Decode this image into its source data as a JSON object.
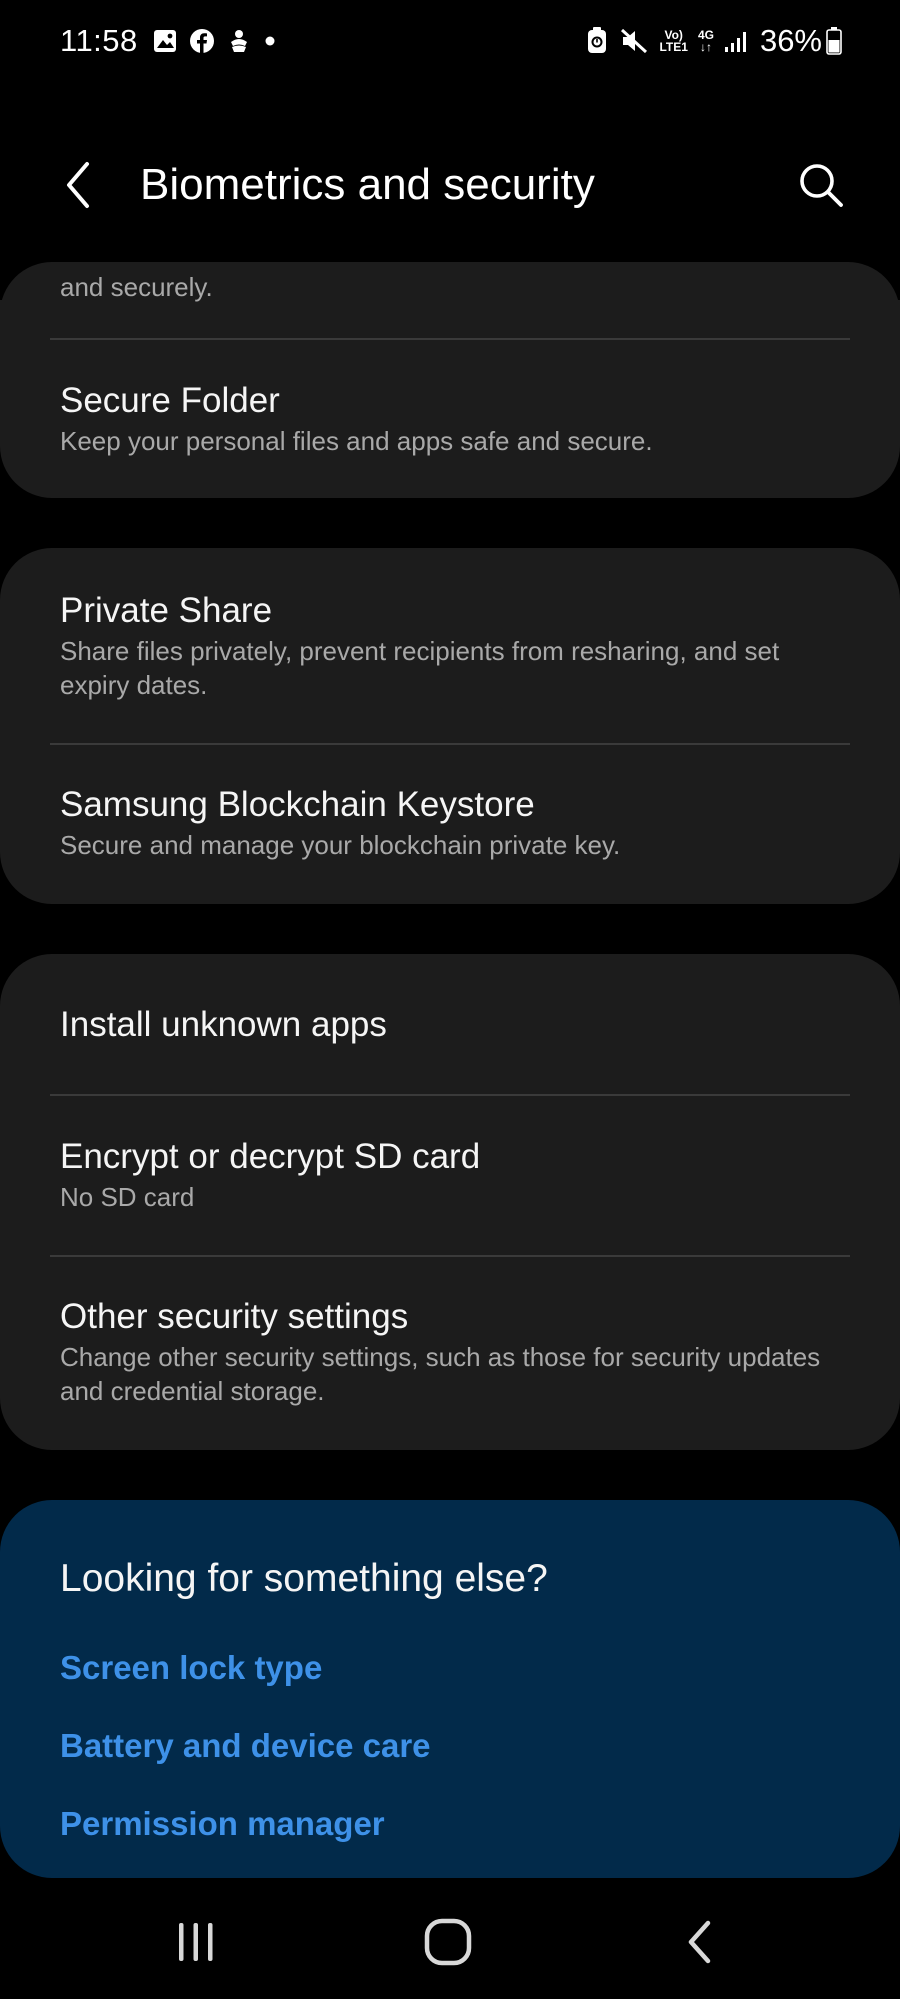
{
  "status_bar": {
    "time": "11:58",
    "notification_icons": [
      "gallery-icon",
      "facebook-icon",
      "game-icon",
      "dot-icon"
    ],
    "network_top": "Vo)",
    "network_bottom": "LTE1",
    "network_type": "4G",
    "battery_percent": "36%"
  },
  "app_bar": {
    "title": "Biometrics and security"
  },
  "group_1": {
    "partial_subtitle": "and securely.",
    "secure_folder": {
      "title": "Secure Folder",
      "subtitle": "Keep your personal files and apps safe and secure."
    }
  },
  "group_2": {
    "private_share": {
      "title": "Private Share",
      "subtitle": "Share files privately, prevent recipients from resharing, and set expiry dates."
    },
    "blockchain": {
      "title": "Samsung Blockchain Keystore",
      "subtitle": "Secure and manage your blockchain private key."
    }
  },
  "group_3": {
    "install_unknown": {
      "title": "Install unknown apps"
    },
    "encrypt_sd": {
      "title": "Encrypt or decrypt SD card",
      "subtitle": "No SD card"
    },
    "other_security": {
      "title": "Other security settings",
      "subtitle": "Change other security settings, such as those for security updates and credential storage."
    }
  },
  "suggestions": {
    "title": "Looking for something else?",
    "links": [
      "Screen lock type",
      "Battery and device care",
      "Permission manager"
    ]
  },
  "colors": {
    "background": "#000000",
    "card": "#1c1c1c",
    "suggest_card": "#022a4a",
    "link": "#3e91e8",
    "subtitle": "#a9a9a9"
  }
}
